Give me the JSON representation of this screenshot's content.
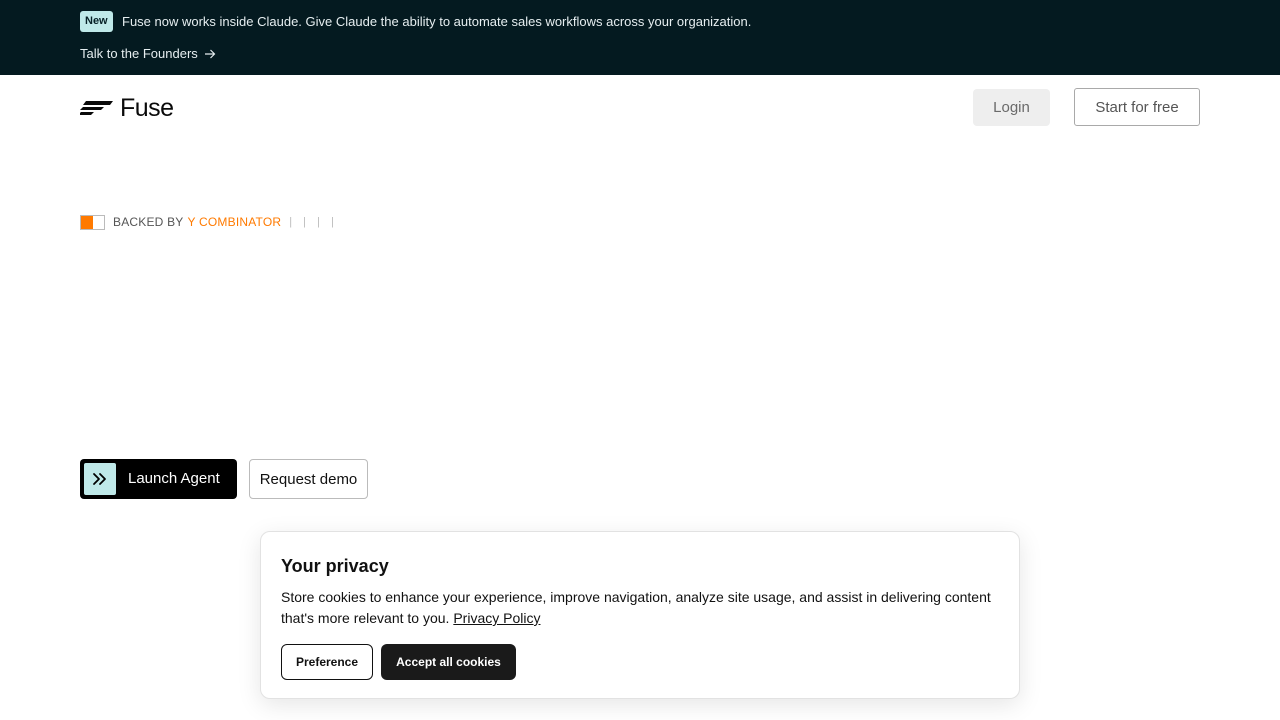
{
  "announcement": {
    "badge": "New",
    "message": "Fuse now works inside Claude. Give Claude the ability to automate sales workflows across your organization.",
    "link_label": "Talk to the Founders",
    "link_icon": "arrow-right-icon"
  },
  "header": {
    "logo_text": "Fuse",
    "login_label": "Login",
    "start_label": "Start for free"
  },
  "hero": {
    "backed_by_label": "BACKED BY",
    "backer_name": "Y COMBINATOR",
    "decoration": "| | | |",
    "launch_label": "Launch Agent",
    "launch_icon": "double-chevron-right-icon",
    "demo_label": "Request demo"
  },
  "cookie_banner": {
    "title": "Your privacy",
    "body": "Store cookies to enhance your experience, improve navigation, analyze site usage, and assist in delivering content that's more relevant to you.",
    "policy_link": "Privacy Policy",
    "preference_label": "Preference",
    "accept_label": "Accept all cookies"
  },
  "colors": {
    "announcement_bg": "#041a20",
    "badge_bg": "#bfe9e9",
    "accent_orange": "#ff7a00",
    "launch_bg": "#000000",
    "accept_bg": "#1a1a1a"
  }
}
